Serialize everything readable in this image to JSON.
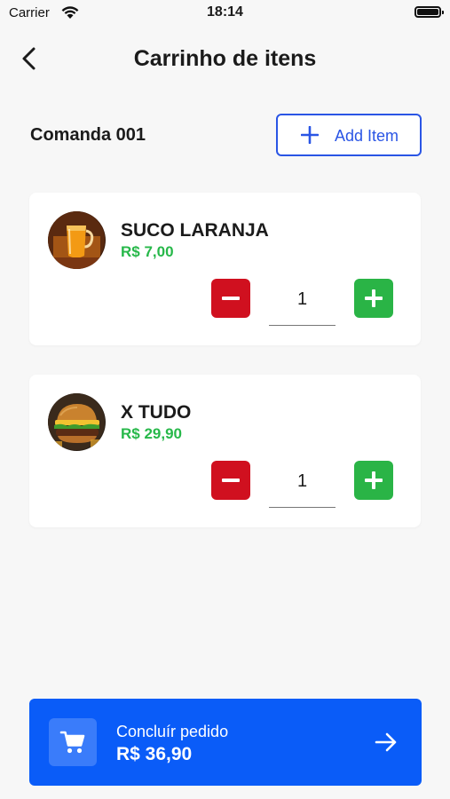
{
  "status_bar": {
    "carrier": "Carrier",
    "time": "18:14",
    "icons": [
      "wifi-icon",
      "battery-icon"
    ]
  },
  "header": {
    "title": "Carrinho de itens",
    "back_icon": "chevron-left-icon"
  },
  "order": {
    "label": "Comanda 001",
    "add_item_label": "Add Item"
  },
  "items": [
    {
      "name": "SUCO LARANJA",
      "price": "R$ 7,00",
      "quantity": "1",
      "image": "orange-juice-pitcher"
    },
    {
      "name": "X TUDO",
      "price": "R$ 29,90",
      "quantity": "1",
      "image": "burger"
    }
  ],
  "checkout": {
    "label": "Concluír pedido",
    "total": "R$ 36,90",
    "icons": [
      "cart-icon",
      "arrow-right-icon"
    ]
  },
  "colors": {
    "accent": "#0a5cf8",
    "outline_blue": "#2a55e5",
    "price_green": "#27b84a",
    "minus_red": "#d0101f",
    "plus_green": "#2ab446",
    "background": "#f7f7f7"
  }
}
